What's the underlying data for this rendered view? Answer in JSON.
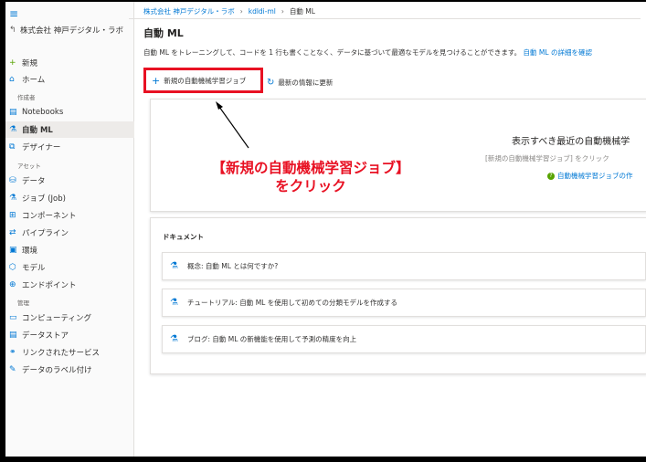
{
  "sidebar": {
    "menu_icon": "≡",
    "workspace": "株式会社 神戸デジタル・ラボ",
    "items": [
      {
        "label": "新規",
        "icon": "+"
      },
      {
        "label": "ホーム",
        "icon": "⌂"
      },
      {
        "label": "Notebooks",
        "icon": "▤"
      },
      {
        "label": "自動 ML",
        "icon": "⚗"
      },
      {
        "label": "デザイナー",
        "icon": "⧉"
      },
      {
        "label": "データ",
        "icon": "⛁"
      },
      {
        "label": "ジョブ (Job)",
        "icon": "⚗"
      },
      {
        "label": "コンポーネント",
        "icon": "⊞"
      },
      {
        "label": "パイプライン",
        "icon": "⇄"
      },
      {
        "label": "環境",
        "icon": "▣"
      },
      {
        "label": "モデル",
        "icon": "⬡"
      },
      {
        "label": "エンドポイント",
        "icon": "⊕"
      },
      {
        "label": "コンピューティング",
        "icon": "▭"
      },
      {
        "label": "データストア",
        "icon": "▤"
      },
      {
        "label": "リンクされたサービス",
        "icon": "⚭"
      },
      {
        "label": "データのラベル付け",
        "icon": "✎"
      }
    ],
    "sections": {
      "author": "作成者",
      "assets": "アセット",
      "manage": "管理"
    }
  },
  "breadcrumb": {
    "item1": "株式会社 神戸デジタル・ラボ",
    "item2": "kdldi-ml",
    "current": "自動 ML"
  },
  "page": {
    "title": "自動 ML",
    "description": "自動 ML をトレーニングして、コードを 1 行も書くことなく、データに基づいて最適なモデルを見つけることができます。",
    "learn_more": "自動 ML の詳細を確認"
  },
  "toolbar": {
    "new_job": "新規の自動機械学習ジョブ",
    "refresh": "最新の情報に更新"
  },
  "empty_state": {
    "title": "表示すべき最近の自動機械学",
    "hint": "[新規の自動機械学習ジョブ] をクリック",
    "link": "自動機械学習ジョブの作"
  },
  "annotation": {
    "line1": "【新規の自動機械学習ジョブ】",
    "line2": "をクリック"
  },
  "documents": {
    "heading": "ドキュメント",
    "items": [
      {
        "label": "概念: 自動 ML とは何ですか?"
      },
      {
        "label": "チュートリアル: 自動 ML を使用して初めての分類モデルを作成する"
      },
      {
        "label": "ブログ: 自動 ML の新機能を使用して予測の精度を向上"
      }
    ]
  },
  "colors": {
    "accent": "#0078d4",
    "highlight": "#e81123"
  }
}
